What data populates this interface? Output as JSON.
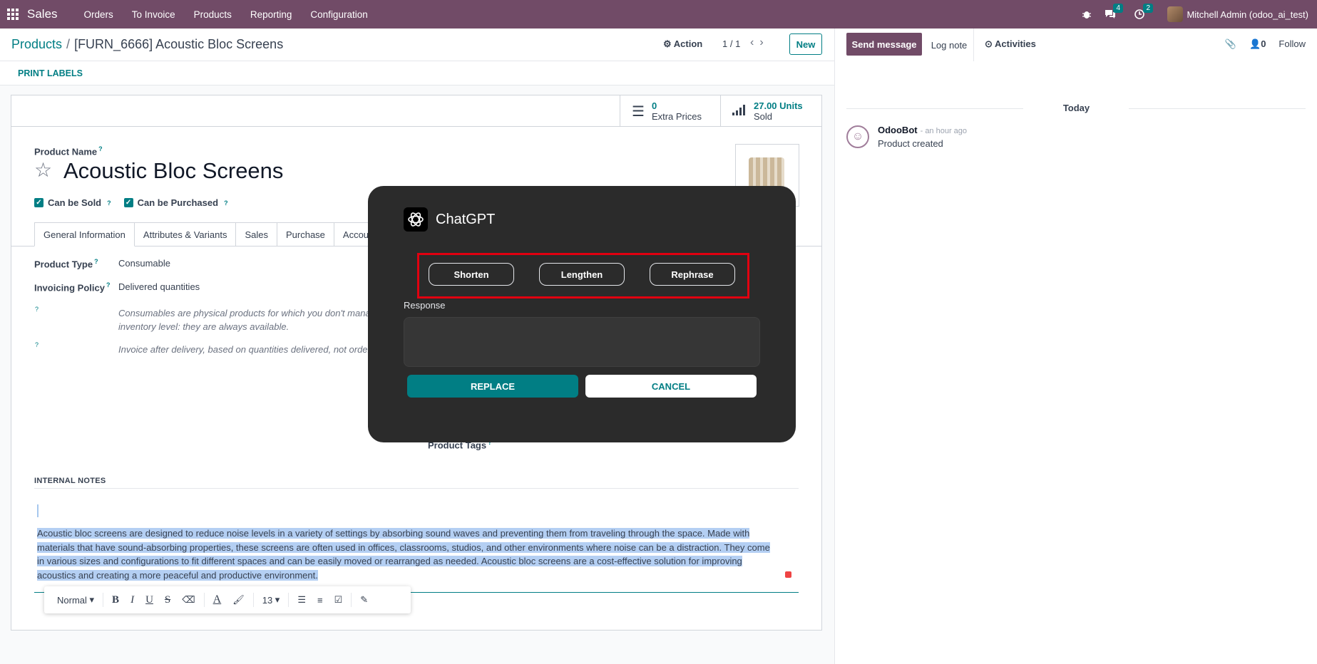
{
  "navbar": {
    "app_name": "Sales",
    "menu": [
      "Orders",
      "To Invoice",
      "Products",
      "Reporting",
      "Configuration"
    ],
    "messages_count": "4",
    "activities_count": "2",
    "user": "Mitchell Admin (odoo_ai_test)"
  },
  "control": {
    "breadcrumb_root": "Products",
    "breadcrumb_sep": "/",
    "breadcrumb_current": "[FURN_6666] Acoustic Bloc Screens",
    "action_label": "Action",
    "pager": "1 / 1",
    "new_label": "New",
    "print_labels": "PRINT LABELS"
  },
  "stats": {
    "extra_prices_value": "0",
    "extra_prices_label": "Extra Prices",
    "sold_value": "27.00 Units",
    "sold_label": "Sold"
  },
  "form": {
    "product_name_label": "Product Name",
    "product_name": "Acoustic Bloc Screens",
    "can_be_sold": "Can be Sold",
    "can_be_purchased": "Can be Purchased",
    "tabs": [
      "General Information",
      "Attributes & Variants",
      "Sales",
      "Purchase",
      "Accou"
    ],
    "product_type_label": "Product Type",
    "product_type": "Consumable",
    "invoicing_policy_label": "Invoicing Policy",
    "invoicing_policy": "Delivered quantities",
    "help1_line1": "Consumables are physical products for which you don't mana",
    "help1_line2": "inventory level: they are always available.",
    "help2": "Invoice after delivery, based on quantities delivered, not order",
    "help_mark": "?",
    "product_tags_label": "Product Tags",
    "internal_notes_title": "INTERNAL NOTES",
    "notes_lines": [
      "Acoustic bloc screens are designed to reduce noise levels in a variety of settings by absorbing sound waves and preventing them from traveling through the space. Made with",
      "materials that have sound-absorbing properties, these screens are often used in offices, classrooms, studios, and other environments where noise can be a distraction. They come",
      "in various sizes and configurations to fit different spaces and can be easily moved or rearranged as needed. Acoustic bloc screens are a cost-effective solution for improving",
      "acoustics and creating a more peaceful and productive environment."
    ]
  },
  "toolbar": {
    "style": "Normal",
    "bold": "B",
    "italic": "I",
    "underline": "U",
    "strike": "S",
    "font_size": "13"
  },
  "chatter": {
    "send_message": "Send message",
    "log_note": "Log note",
    "activities": "Activities",
    "followers_count": "0",
    "follow": "Follow",
    "today": "Today",
    "author": "OdooBot",
    "time": "- an hour ago",
    "body": "Product created"
  },
  "dialog": {
    "title": "ChatGPT",
    "shorten": "Shorten",
    "lengthen": "Lengthen",
    "rephrase": "Rephrase",
    "response_label": "Response",
    "replace": "REPLACE",
    "cancel": "CANCEL"
  },
  "colors": {
    "brand": "#714b67",
    "accent": "#017e84",
    "dialog_bg": "#2b2b2b",
    "highlight": "#e10010"
  }
}
